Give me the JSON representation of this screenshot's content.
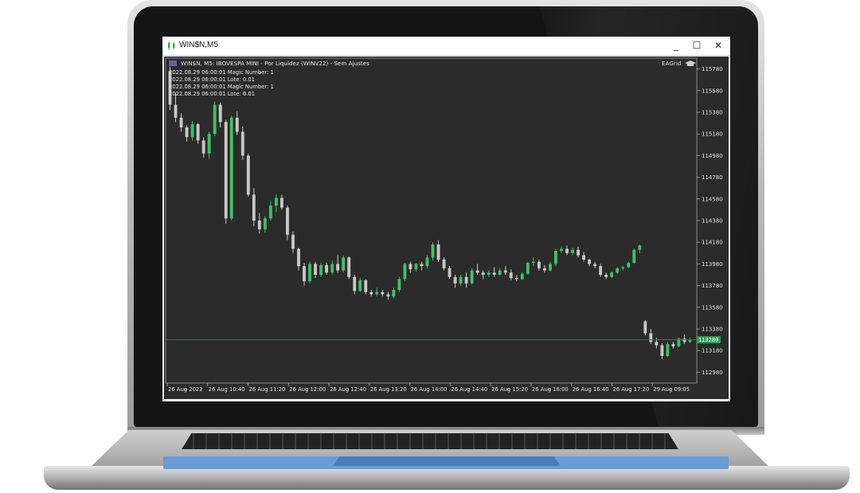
{
  "window": {
    "title": "WIN$N,M5",
    "minimize_glyph": "_",
    "maximize_glyph": "☐",
    "close_glyph": "✕"
  },
  "chart": {
    "header": "WIN$N, M5:  IBOVESPA MINI - Por Liquidez (WINV22) - Sem Ajustes",
    "expert_name": "EAGrid",
    "expert_icon": "graduation-cap-icon",
    "log_lines": [
      "2022.08.29 06:00:01 Magic Number: 1",
      "2022.08.29 06:00:01 Lote: 0.01",
      "2022.08.29 06:00:01 Magic Number: 1",
      "2022.08.29 06:00:01 Lote: 0.01"
    ],
    "price_labels": [
      "115780",
      "115580",
      "115380",
      "115180",
      "114980",
      "114780",
      "114580",
      "114380",
      "114180",
      "113980",
      "113780",
      "113580",
      "113380",
      "113180",
      "112980"
    ],
    "current_price": "113280",
    "time_labels": [
      "26 Aug 2022",
      "26 Aug 10:40",
      "26 Aug 11:20",
      "26 Aug 12:00",
      "26 Aug 12:40",
      "26 Aug 13:20",
      "26 Aug 14:00",
      "26 Aug 14:40",
      "26 Aug 15:20",
      "26 Aug 16:00",
      "26 Aug 16:40",
      "26 Aug 17:20",
      "29 Aug 09:05"
    ],
    "colors": {
      "background": "#2b2b2b",
      "bull": "#3fbf6a",
      "bear": "#c8c8c8",
      "price_line": "#2e7d4f",
      "axis_text": "#e0e0e0"
    }
  },
  "chart_data": {
    "type": "candlestick",
    "symbol": "WIN$N",
    "timeframe": "M5",
    "ylim": [
      112880,
      115880
    ],
    "current_price": 113280,
    "candles": [
      [
        115760,
        115800,
        115400,
        115450
      ],
      [
        115450,
        115560,
        115290,
        115330
      ],
      [
        115330,
        115370,
        115200,
        115240
      ],
      [
        115240,
        115260,
        115110,
        115150
      ],
      [
        115150,
        115300,
        115120,
        115270
      ],
      [
        115270,
        115280,
        115090,
        115120
      ],
      [
        115120,
        115150,
        114960,
        115000
      ],
      [
        115000,
        115200,
        114950,
        115180
      ],
      [
        115180,
        115480,
        115160,
        115450
      ],
      [
        115450,
        115470,
        115240,
        115290
      ],
      [
        115290,
        115310,
        114350,
        114400
      ],
      [
        114400,
        115350,
        114380,
        115330
      ],
      [
        115330,
        115390,
        115170,
        115200
      ],
      [
        115200,
        115250,
        114940,
        114980
      ],
      [
        114980,
        115000,
        114600,
        114620
      ],
      [
        114620,
        114680,
        114330,
        114380
      ],
      [
        114380,
        114450,
        114260,
        114300
      ],
      [
        114300,
        114420,
        114270,
        114400
      ],
      [
        114400,
        114560,
        114380,
        114520
      ],
      [
        114520,
        114620,
        114460,
        114590
      ],
      [
        114590,
        114620,
        114480,
        114500
      ],
      [
        114500,
        114520,
        114200,
        114250
      ],
      [
        114250,
        114280,
        114080,
        114120
      ],
      [
        114120,
        114130,
        113920,
        113960
      ],
      [
        113960,
        113990,
        113780,
        113820
      ],
      [
        113820,
        114000,
        113800,
        113980
      ],
      [
        113980,
        114000,
        113850,
        113880
      ],
      [
        113880,
        113990,
        113860,
        113970
      ],
      [
        113970,
        113990,
        113880,
        113900
      ],
      [
        113900,
        114010,
        113880,
        113980
      ],
      [
        113980,
        114060,
        113900,
        113920
      ],
      [
        113920,
        114060,
        113900,
        114040
      ],
      [
        114040,
        114050,
        113840,
        113860
      ],
      [
        113860,
        113880,
        113700,
        113730
      ],
      [
        113730,
        113850,
        113720,
        113830
      ],
      [
        113830,
        113840,
        113700,
        113720
      ],
      [
        113720,
        113740,
        113680,
        113700
      ],
      [
        113700,
        113760,
        113680,
        113720
      ],
      [
        113720,
        113740,
        113680,
        113700
      ],
      [
        113700,
        113720,
        113650,
        113680
      ],
      [
        113680,
        113760,
        113660,
        113740
      ],
      [
        113740,
        113860,
        113720,
        113840
      ],
      [
        113840,
        113990,
        113820,
        113980
      ],
      [
        113980,
        114000,
        113900,
        113930
      ],
      [
        113930,
        113990,
        113910,
        113980
      ],
      [
        113980,
        114000,
        113920,
        113960
      ],
      [
        113960,
        114060,
        113940,
        114040
      ],
      [
        114040,
        114180,
        114010,
        114160
      ],
      [
        114160,
        114200,
        114000,
        114020
      ],
      [
        114020,
        114040,
        113920,
        113940
      ],
      [
        113940,
        113960,
        113840,
        113860
      ],
      [
        113860,
        113880,
        113760,
        113800
      ],
      [
        113800,
        113880,
        113780,
        113860
      ],
      [
        113860,
        113900,
        113760,
        113800
      ],
      [
        113800,
        113940,
        113790,
        113920
      ],
      [
        113920,
        113980,
        113880,
        113900
      ],
      [
        113900,
        113920,
        113840,
        113880
      ],
      [
        113880,
        113920,
        113860,
        113900
      ],
      [
        113900,
        113950,
        113860,
        113880
      ],
      [
        113880,
        113940,
        113870,
        113920
      ],
      [
        113920,
        113960,
        113880,
        113900
      ],
      [
        113900,
        113930,
        113830,
        113850
      ],
      [
        113850,
        113880,
        113820,
        113840
      ],
      [
        113840,
        113900,
        113830,
        113890
      ],
      [
        113890,
        114000,
        113880,
        113990
      ],
      [
        113990,
        114040,
        113960,
        114000
      ],
      [
        114000,
        114020,
        113920,
        113940
      ],
      [
        113940,
        113970,
        113900,
        113920
      ],
      [
        113920,
        114000,
        113910,
        113980
      ],
      [
        113980,
        114120,
        113960,
        114100
      ],
      [
        114100,
        114140,
        114080,
        114120
      ],
      [
        114120,
        114150,
        114060,
        114080
      ],
      [
        114080,
        114130,
        114060,
        114110
      ],
      [
        114110,
        114140,
        114040,
        114060
      ],
      [
        114060,
        114090,
        114000,
        114020
      ],
      [
        114020,
        114030,
        113960,
        113980
      ],
      [
        113980,
        114000,
        113940,
        113960
      ],
      [
        113960,
        113980,
        113860,
        113880
      ],
      [
        113880,
        113900,
        113840,
        113860
      ],
      [
        113860,
        113910,
        113850,
        113900
      ],
      [
        113900,
        113950,
        113890,
        113940
      ],
      [
        113940,
        113960,
        113920,
        113950
      ],
      [
        113950,
        114000,
        113940,
        113990
      ],
      [
        113990,
        114120,
        113980,
        114110
      ],
      [
        114110,
        114160,
        114080,
        114150
      ],
      [
        113450,
        113460,
        113320,
        113340
      ],
      [
        113340,
        113380,
        113240,
        113260
      ],
      [
        113260,
        113300,
        113200,
        113230
      ],
      [
        113230,
        113250,
        113100,
        113130
      ],
      [
        113130,
        113260,
        113120,
        113240
      ],
      [
        113240,
        113260,
        113200,
        113220
      ],
      [
        113220,
        113300,
        113210,
        113290
      ],
      [
        113290,
        113330,
        113240,
        113260
      ],
      [
        113260,
        113300,
        113250,
        113280
      ]
    ]
  }
}
